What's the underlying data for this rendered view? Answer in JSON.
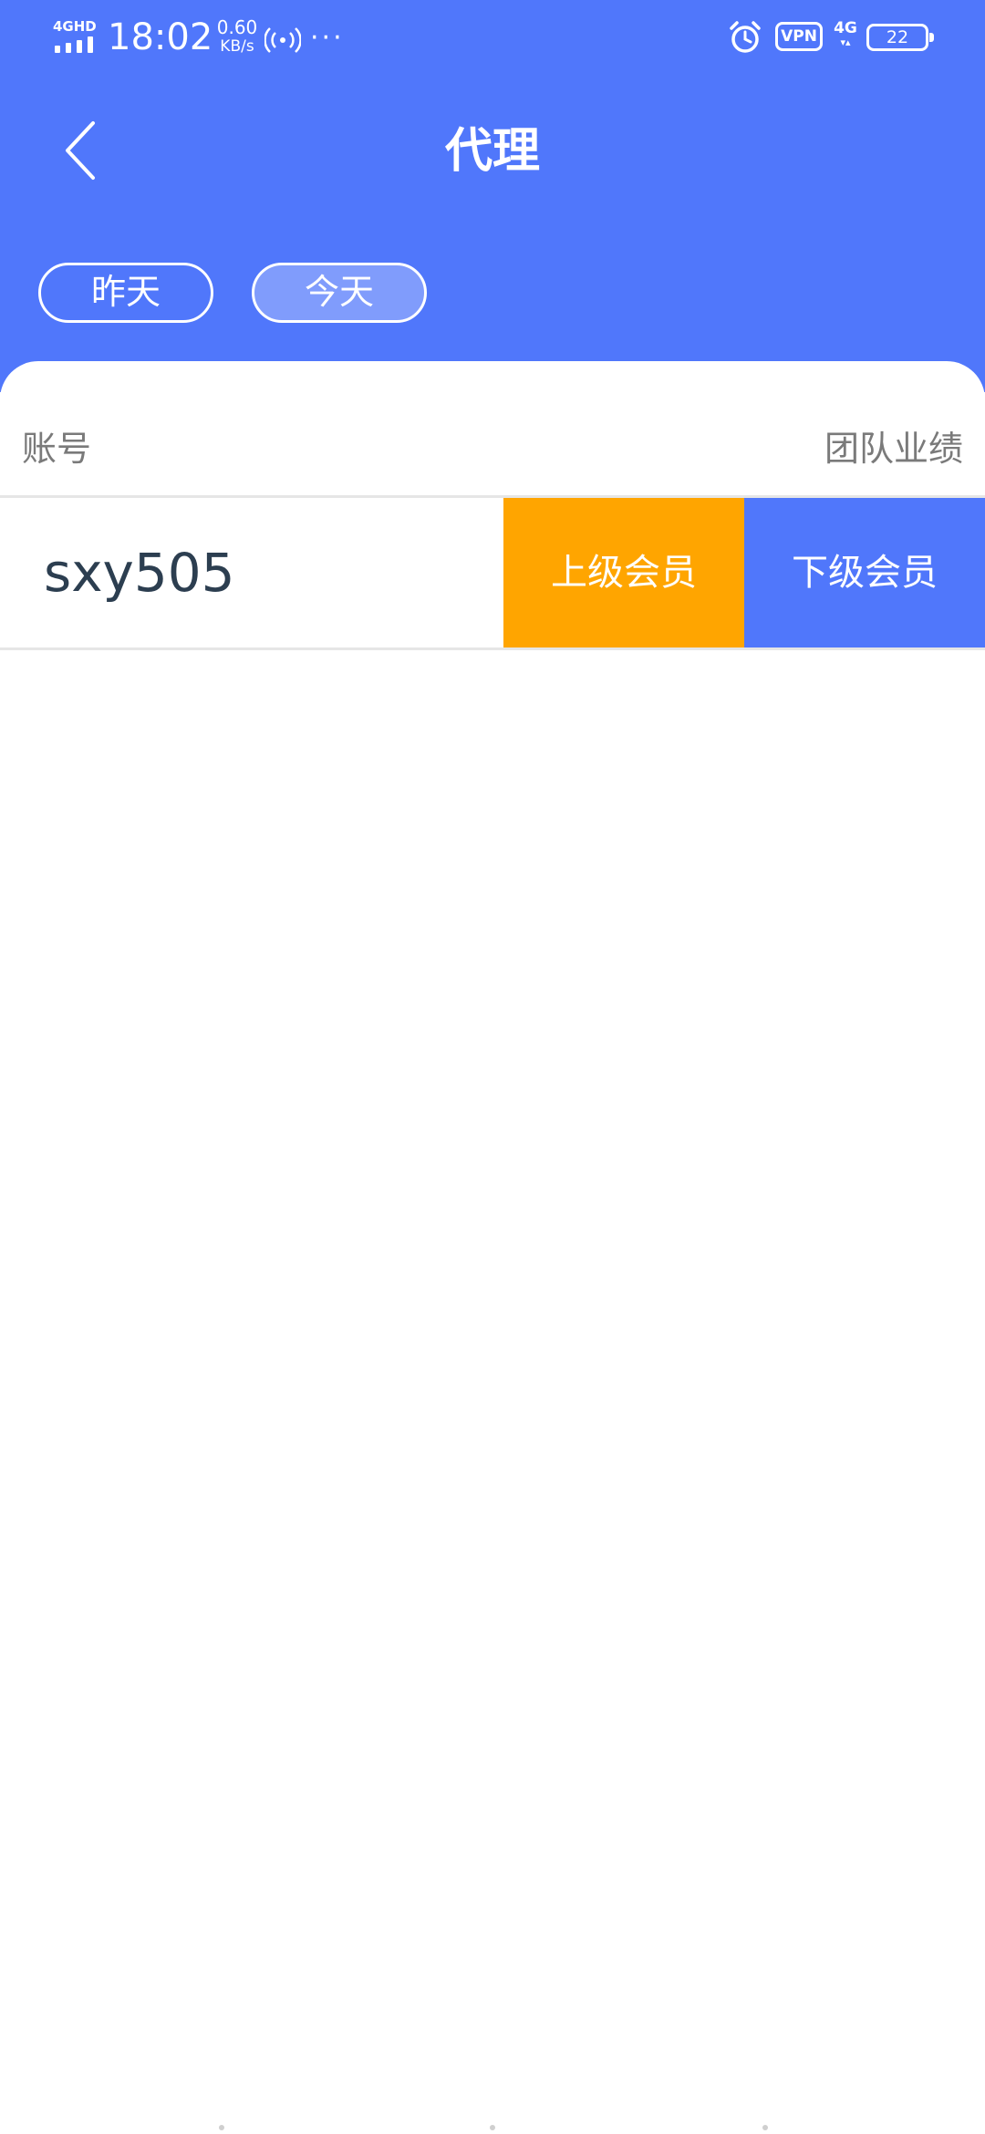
{
  "status_bar": {
    "network": "4GHD",
    "time": "18:02",
    "speed_value": "0.60",
    "speed_unit": "KB/s",
    "more": "···",
    "vpn": "VPN",
    "cell": "4G",
    "battery": "22",
    "icons": [
      "signal-icon",
      "hotspot-icon",
      "alarm-icon",
      "battery-icon"
    ]
  },
  "nav": {
    "back_icon": "chevron-left-icon",
    "title": "代理"
  },
  "filters": {
    "yesterday": "昨天",
    "today": "今天",
    "selected": "today"
  },
  "table": {
    "headers": {
      "account": "账号",
      "team_performance": "团队业绩"
    },
    "rows": [
      {
        "account": "sxy505",
        "superior_label": "上级会员",
        "subordinate_label": "下级会员"
      }
    ]
  },
  "colors": {
    "primary": "#5077FB",
    "accent_orange": "#FFA500",
    "text_dark": "#2c3e50",
    "text_muted": "#7a7a7a"
  }
}
